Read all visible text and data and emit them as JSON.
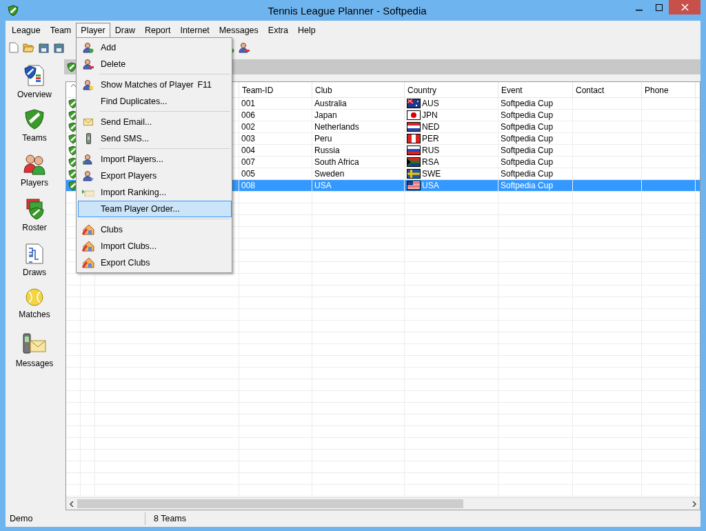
{
  "window": {
    "title": "Tennis League Planner - Softpedia"
  },
  "menu_bar": [
    {
      "label": "League",
      "selected": false
    },
    {
      "label": "Team",
      "selected": false
    },
    {
      "label": "Player",
      "selected": true
    },
    {
      "label": "Draw",
      "selected": false
    },
    {
      "label": "Report",
      "selected": false
    },
    {
      "label": "Internet",
      "selected": false
    },
    {
      "label": "Messages",
      "selected": false
    },
    {
      "label": "Extra",
      "selected": false
    },
    {
      "label": "Help",
      "selected": false
    }
  ],
  "player_menu": [
    {
      "kind": "item",
      "label": "Add",
      "selected": false
    },
    {
      "kind": "item",
      "label": "Delete",
      "selected": false
    },
    {
      "kind": "separator"
    },
    {
      "kind": "item",
      "label": "Show Matches of Player",
      "shortcut": "F11",
      "selected": false
    },
    {
      "kind": "item",
      "label": "Find Duplicates...",
      "selected": false
    },
    {
      "kind": "separator"
    },
    {
      "kind": "item",
      "label": "Send Email...",
      "selected": false
    },
    {
      "kind": "item",
      "label": "Send SMS...",
      "selected": false
    },
    {
      "kind": "separator"
    },
    {
      "kind": "item",
      "label": "Import Players...",
      "selected": false
    },
    {
      "kind": "item",
      "label": "Export Players",
      "selected": false
    },
    {
      "kind": "item",
      "label": "Import Ranking...",
      "selected": false
    },
    {
      "kind": "item",
      "label": "Team Player Order...",
      "selected": true
    },
    {
      "kind": "separator"
    },
    {
      "kind": "item",
      "label": "Clubs",
      "selected": false
    },
    {
      "kind": "item",
      "label": "Import Clubs...",
      "selected": false
    },
    {
      "kind": "item",
      "label": "Export Clubs",
      "selected": false
    }
  ],
  "sidebar": {
    "items": [
      {
        "label": "Overview"
      },
      {
        "label": "Teams"
      },
      {
        "label": "Players"
      },
      {
        "label": "Roster"
      },
      {
        "label": "Draws"
      },
      {
        "label": "Matches"
      },
      {
        "label": "Messages"
      }
    ]
  },
  "table": {
    "columns": [
      "Team-ID",
      "Club",
      "Country",
      "Event",
      "Contact",
      "Phone"
    ],
    "rows": [
      {
        "team_id": "001",
        "club": "Australia",
        "kind": "aus",
        "country": "AUS",
        "event": "Softpedia Cup",
        "selected": false
      },
      {
        "team_id": "006",
        "club": "Japan",
        "kind": "jpn",
        "country": "JPN",
        "event": "Softpedia Cup",
        "selected": false
      },
      {
        "team_id": "002",
        "club": "Netherlands",
        "kind": "ned",
        "country": "NED",
        "event": "Softpedia Cup",
        "selected": false
      },
      {
        "team_id": "003",
        "club": "Peru",
        "kind": "per",
        "country": "PER",
        "event": "Softpedia Cup",
        "selected": false
      },
      {
        "team_id": "004",
        "club": "Russia",
        "kind": "rus",
        "country": "RUS",
        "event": "Softpedia Cup",
        "selected": false
      },
      {
        "team_id": "007",
        "club": "South Africa",
        "kind": "rsa",
        "country": "RSA",
        "event": "Softpedia Cup",
        "selected": false
      },
      {
        "team_id": "005",
        "club": "Sweden",
        "kind": "swe",
        "country": "SWE",
        "event": "Softpedia Cup",
        "selected": false
      },
      {
        "team_id": "008",
        "club": "USA",
        "kind": "usa",
        "country": "USA",
        "event": "Softpedia Cup",
        "selected": true
      }
    ]
  },
  "status_bar": [
    "Demo",
    "8 Teams"
  ]
}
